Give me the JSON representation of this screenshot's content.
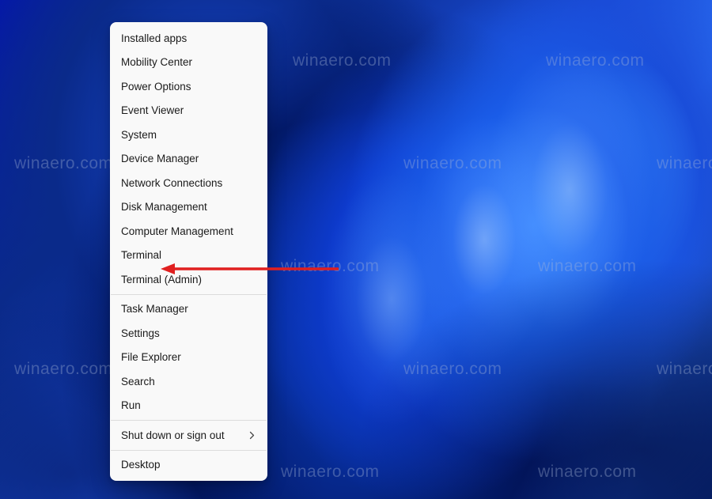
{
  "watermark_text": "winaero.com",
  "menu": {
    "groups": [
      [
        {
          "id": "installed-apps",
          "label": "Installed apps",
          "submenu": false
        },
        {
          "id": "mobility-center",
          "label": "Mobility Center",
          "submenu": false
        },
        {
          "id": "power-options",
          "label": "Power Options",
          "submenu": false
        },
        {
          "id": "event-viewer",
          "label": "Event Viewer",
          "submenu": false
        },
        {
          "id": "system",
          "label": "System",
          "submenu": false
        },
        {
          "id": "device-manager",
          "label": "Device Manager",
          "submenu": false
        },
        {
          "id": "network-connections",
          "label": "Network Connections",
          "submenu": false
        },
        {
          "id": "disk-management",
          "label": "Disk Management",
          "submenu": false
        },
        {
          "id": "computer-management",
          "label": "Computer Management",
          "submenu": false
        },
        {
          "id": "terminal",
          "label": "Terminal",
          "submenu": false
        },
        {
          "id": "terminal-admin",
          "label": "Terminal (Admin)",
          "submenu": false
        }
      ],
      [
        {
          "id": "task-manager",
          "label": "Task Manager",
          "submenu": false
        },
        {
          "id": "settings",
          "label": "Settings",
          "submenu": false
        },
        {
          "id": "file-explorer",
          "label": "File Explorer",
          "submenu": false
        },
        {
          "id": "search",
          "label": "Search",
          "submenu": false
        },
        {
          "id": "run",
          "label": "Run",
          "submenu": false
        }
      ],
      [
        {
          "id": "shut-down",
          "label": "Shut down or sign out",
          "submenu": true
        }
      ],
      [
        {
          "id": "desktop",
          "label": "Desktop",
          "submenu": false
        }
      ]
    ]
  },
  "annotation": {
    "target": "terminal",
    "color": "#e02020"
  }
}
